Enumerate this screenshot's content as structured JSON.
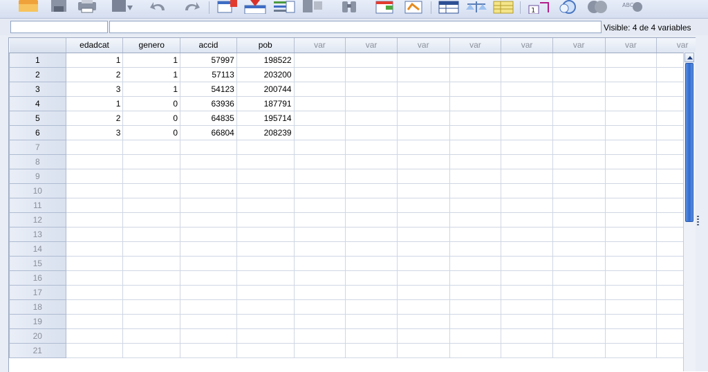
{
  "toolbar": {
    "icons": [
      "open-folder-icon",
      "save-icon",
      "print-icon",
      "dialog-recall-icon",
      "undo-icon",
      "redo-icon",
      "goto-case-icon",
      "goto-variable-icon",
      "variables-icon",
      "find-icon",
      "binoculars-icon",
      "insert-cases-icon",
      "insert-variable-icon",
      "split-file-icon",
      "weight-cases-icon",
      "select-cases-icon",
      "value-labels-icon",
      "use-sets-icon",
      "show-all-variables-icon",
      "spell-check-icon"
    ]
  },
  "cellbar": {
    "cell_ref": "",
    "cell_value": "",
    "visible": "Visible: 4 de 4 variables"
  },
  "grid": {
    "columns": [
      "edadcat",
      "genero",
      "accid",
      "pob",
      "var",
      "var",
      "var",
      "var",
      "var",
      "var",
      "var",
      "var"
    ],
    "rows": [
      {
        "n": "1",
        "cells": [
          "1",
          "1",
          "57997",
          "198522"
        ]
      },
      {
        "n": "2",
        "cells": [
          "2",
          "1",
          "57113",
          "203200"
        ]
      },
      {
        "n": "3",
        "cells": [
          "3",
          "1",
          "54123",
          "200744"
        ]
      },
      {
        "n": "4",
        "cells": [
          "1",
          "0",
          "63936",
          "187791"
        ]
      },
      {
        "n": "5",
        "cells": [
          "2",
          "0",
          "64835",
          "195714"
        ]
      },
      {
        "n": "6",
        "cells": [
          "3",
          "0",
          "66804",
          "208239"
        ]
      },
      {
        "n": "7",
        "cells": []
      },
      {
        "n": "8",
        "cells": []
      },
      {
        "n": "9",
        "cells": []
      },
      {
        "n": "10",
        "cells": []
      },
      {
        "n": "11",
        "cells": []
      },
      {
        "n": "12",
        "cells": []
      },
      {
        "n": "13",
        "cells": []
      },
      {
        "n": "14",
        "cells": []
      },
      {
        "n": "15",
        "cells": []
      },
      {
        "n": "16",
        "cells": []
      },
      {
        "n": "17",
        "cells": []
      },
      {
        "n": "18",
        "cells": []
      },
      {
        "n": "19",
        "cells": []
      },
      {
        "n": "20",
        "cells": []
      },
      {
        "n": "21",
        "cells": []
      }
    ]
  }
}
